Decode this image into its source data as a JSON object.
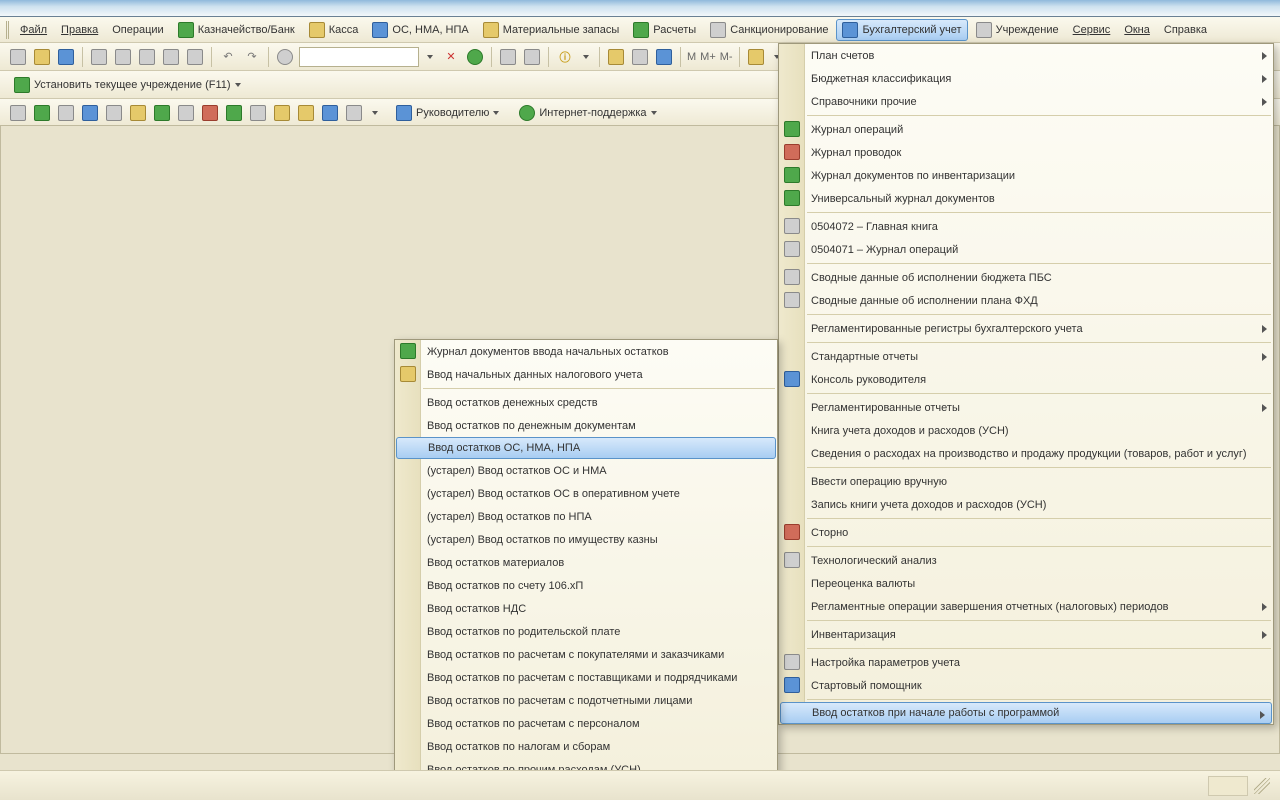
{
  "menu": {
    "file": "Файл",
    "edit": "Правка",
    "ops": "Операции",
    "treasury": "Казначейство/Банк",
    "cash": "Касса",
    "os": "ОС, НМА, НПА",
    "materials": "Материальные запасы",
    "calc": "Расчеты",
    "sanction": "Санкционирование",
    "accounting": "Бухгалтерский учет",
    "institution": "Учреждение",
    "service": "Сервис",
    "windows": "Окна",
    "help": "Справка"
  },
  "toolbar2_m": "М",
  "toolbar2_mplus": "М+",
  "toolbar2_mminus": "М-",
  "institution_button": "Установить текущее учреждение (F11)",
  "leader_button": "Руководителю",
  "support_button": "Интернет-поддержка",
  "search": {
    "placeholder": ""
  },
  "drop_main": [
    {
      "label": "План счетов",
      "arrow": true
    },
    {
      "label": "Бюджетная классификация",
      "arrow": true
    },
    {
      "label": "Справочники прочие",
      "arrow": true
    },
    {
      "sep": true
    },
    {
      "label": "Журнал операций",
      "icon": "green"
    },
    {
      "label": "Журнал проводок",
      "icon": "red"
    },
    {
      "label": "Журнал документов по инвентаризации",
      "icon": "green"
    },
    {
      "label": "Универсальный журнал документов",
      "icon": "green"
    },
    {
      "sep": true
    },
    {
      "label": "0504072 – Главная книга",
      "icon": "gray"
    },
    {
      "label": "0504071 – Журнал операций",
      "icon": "gray"
    },
    {
      "sep": true
    },
    {
      "label": "Сводные данные об исполнении бюджета ПБС",
      "icon": "gray"
    },
    {
      "label": "Сводные данные об исполнении плана ФХД",
      "icon": "gray"
    },
    {
      "sep": true
    },
    {
      "label": "Регламентированные регистры бухгалтерского учета",
      "arrow": true
    },
    {
      "sep": true
    },
    {
      "label": "Стандартные отчеты",
      "arrow": true
    },
    {
      "label": "Консоль руководителя",
      "icon": "blue"
    },
    {
      "sep": true
    },
    {
      "label": "Регламентированные отчеты",
      "arrow": true
    },
    {
      "label": "Книга учета доходов и расходов (УСН)"
    },
    {
      "label": "Сведения о расходах на производство и продажу продукции (товаров, работ и услуг)"
    },
    {
      "sep": true
    },
    {
      "label": "Ввести операцию вручную"
    },
    {
      "label": "Запись книги учета доходов и расходов (УСН)"
    },
    {
      "sep": true
    },
    {
      "label": "Сторно",
      "icon": "red"
    },
    {
      "sep": true
    },
    {
      "label": "Технологический анализ",
      "icon": "gray"
    },
    {
      "label": "Переоценка валюты"
    },
    {
      "label": "Регламентные операции завершения отчетных (налоговых) периодов",
      "arrow": true
    },
    {
      "sep": true
    },
    {
      "label": "Инвентаризация",
      "arrow": true
    },
    {
      "sep": true
    },
    {
      "label": "Настройка параметров учета",
      "icon": "gray"
    },
    {
      "label": "Стартовый помощник",
      "icon": "blue"
    },
    {
      "sep": true
    },
    {
      "label": "Ввод остатков при начале работы с программой",
      "arrow": true,
      "highlight": true
    }
  ],
  "drop_sub": [
    {
      "label": "Журнал документов ввода начальных остатков",
      "icon": "green"
    },
    {
      "label": "Ввод начальных данных налогового учета",
      "icon": "gold"
    },
    {
      "sep": true
    },
    {
      "label": "Ввод остатков денежных средств"
    },
    {
      "label": "Ввод остатков по денежным документам"
    },
    {
      "label": "Ввод остатков ОС, НМА, НПА",
      "highlight": true
    },
    {
      "label": "(устарел) Ввод остатков ОС и НМА"
    },
    {
      "label": "(устарел) Ввод остатков ОС в оперативном учете"
    },
    {
      "label": "(устарел) Ввод остатков по НПА"
    },
    {
      "label": "(устарел) Ввод остатков по имуществу казны"
    },
    {
      "label": "Ввод остатков материалов"
    },
    {
      "label": "Ввод остатков по счету 106.хП"
    },
    {
      "label": "Ввод остатков НДС"
    },
    {
      "label": "Ввод остатков по родительской плате"
    },
    {
      "label": "Ввод остатков по расчетам с покупателями и заказчиками"
    },
    {
      "label": "Ввод остатков по расчетам с поставщиками и подрядчиками"
    },
    {
      "label": "Ввод остатков по расчетам с подотчетными лицами"
    },
    {
      "label": "Ввод остатков по расчетам с персоналом"
    },
    {
      "label": "Ввод остатков по налогам и сборам"
    },
    {
      "label": "Ввод остатков по прочим расходам (УСН)"
    }
  ]
}
